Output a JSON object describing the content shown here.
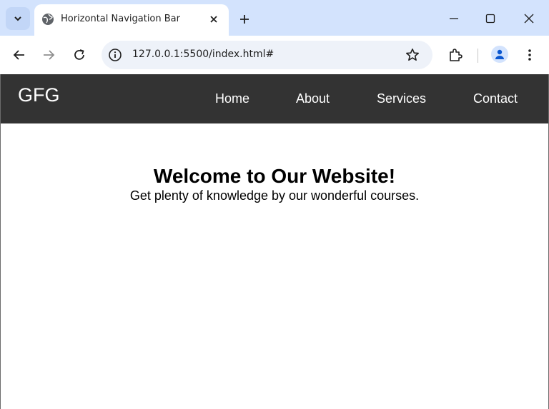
{
  "browser": {
    "tab_title": "Horizontal Navigation Bar",
    "url": "127.0.0.1:5500/index.html#"
  },
  "page": {
    "logo": "GFG",
    "nav": [
      {
        "label": "Home"
      },
      {
        "label": "About"
      },
      {
        "label": "Services"
      },
      {
        "label": "Contact"
      }
    ],
    "heading": "Welcome to Our Website!",
    "subheading": "Get plenty of knowledge by our wonderful courses."
  },
  "colors": {
    "tabstrip": "#d3e3fd",
    "navbar": "#333333",
    "nav_text": "#ffffff"
  }
}
